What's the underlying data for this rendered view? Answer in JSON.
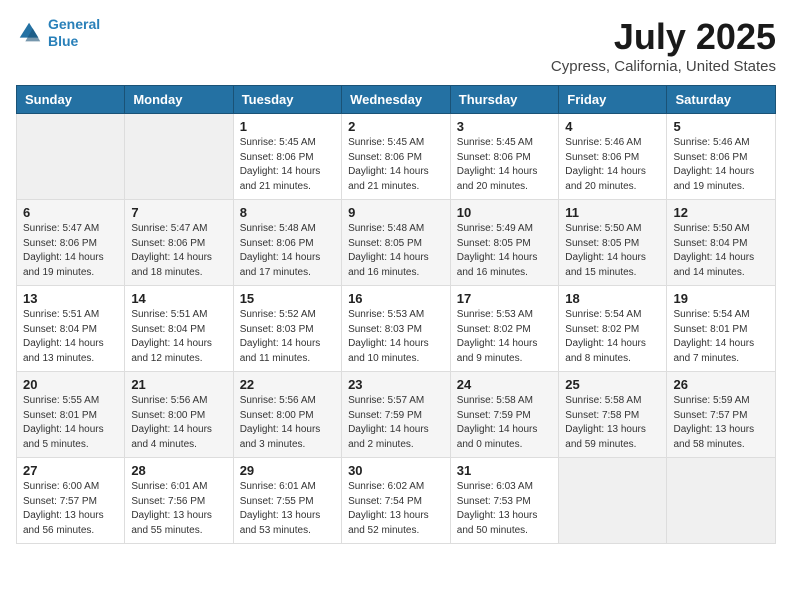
{
  "logo": {
    "line1": "General",
    "line2": "Blue"
  },
  "title": "July 2025",
  "subtitle": "Cypress, California, United States",
  "weekdays": [
    "Sunday",
    "Monday",
    "Tuesday",
    "Wednesday",
    "Thursday",
    "Friday",
    "Saturday"
  ],
  "weeks": [
    [
      {
        "day": "",
        "info": ""
      },
      {
        "day": "",
        "info": ""
      },
      {
        "day": "1",
        "info": "Sunrise: 5:45 AM\nSunset: 8:06 PM\nDaylight: 14 hours and 21 minutes."
      },
      {
        "day": "2",
        "info": "Sunrise: 5:45 AM\nSunset: 8:06 PM\nDaylight: 14 hours and 21 minutes."
      },
      {
        "day": "3",
        "info": "Sunrise: 5:45 AM\nSunset: 8:06 PM\nDaylight: 14 hours and 20 minutes."
      },
      {
        "day": "4",
        "info": "Sunrise: 5:46 AM\nSunset: 8:06 PM\nDaylight: 14 hours and 20 minutes."
      },
      {
        "day": "5",
        "info": "Sunrise: 5:46 AM\nSunset: 8:06 PM\nDaylight: 14 hours and 19 minutes."
      }
    ],
    [
      {
        "day": "6",
        "info": "Sunrise: 5:47 AM\nSunset: 8:06 PM\nDaylight: 14 hours and 19 minutes."
      },
      {
        "day": "7",
        "info": "Sunrise: 5:47 AM\nSunset: 8:06 PM\nDaylight: 14 hours and 18 minutes."
      },
      {
        "day": "8",
        "info": "Sunrise: 5:48 AM\nSunset: 8:06 PM\nDaylight: 14 hours and 17 minutes."
      },
      {
        "day": "9",
        "info": "Sunrise: 5:48 AM\nSunset: 8:05 PM\nDaylight: 14 hours and 16 minutes."
      },
      {
        "day": "10",
        "info": "Sunrise: 5:49 AM\nSunset: 8:05 PM\nDaylight: 14 hours and 16 minutes."
      },
      {
        "day": "11",
        "info": "Sunrise: 5:50 AM\nSunset: 8:05 PM\nDaylight: 14 hours and 15 minutes."
      },
      {
        "day": "12",
        "info": "Sunrise: 5:50 AM\nSunset: 8:04 PM\nDaylight: 14 hours and 14 minutes."
      }
    ],
    [
      {
        "day": "13",
        "info": "Sunrise: 5:51 AM\nSunset: 8:04 PM\nDaylight: 14 hours and 13 minutes."
      },
      {
        "day": "14",
        "info": "Sunrise: 5:51 AM\nSunset: 8:04 PM\nDaylight: 14 hours and 12 minutes."
      },
      {
        "day": "15",
        "info": "Sunrise: 5:52 AM\nSunset: 8:03 PM\nDaylight: 14 hours and 11 minutes."
      },
      {
        "day": "16",
        "info": "Sunrise: 5:53 AM\nSunset: 8:03 PM\nDaylight: 14 hours and 10 minutes."
      },
      {
        "day": "17",
        "info": "Sunrise: 5:53 AM\nSunset: 8:02 PM\nDaylight: 14 hours and 9 minutes."
      },
      {
        "day": "18",
        "info": "Sunrise: 5:54 AM\nSunset: 8:02 PM\nDaylight: 14 hours and 8 minutes."
      },
      {
        "day": "19",
        "info": "Sunrise: 5:54 AM\nSunset: 8:01 PM\nDaylight: 14 hours and 7 minutes."
      }
    ],
    [
      {
        "day": "20",
        "info": "Sunrise: 5:55 AM\nSunset: 8:01 PM\nDaylight: 14 hours and 5 minutes."
      },
      {
        "day": "21",
        "info": "Sunrise: 5:56 AM\nSunset: 8:00 PM\nDaylight: 14 hours and 4 minutes."
      },
      {
        "day": "22",
        "info": "Sunrise: 5:56 AM\nSunset: 8:00 PM\nDaylight: 14 hours and 3 minutes."
      },
      {
        "day": "23",
        "info": "Sunrise: 5:57 AM\nSunset: 7:59 PM\nDaylight: 14 hours and 2 minutes."
      },
      {
        "day": "24",
        "info": "Sunrise: 5:58 AM\nSunset: 7:59 PM\nDaylight: 14 hours and 0 minutes."
      },
      {
        "day": "25",
        "info": "Sunrise: 5:58 AM\nSunset: 7:58 PM\nDaylight: 13 hours and 59 minutes."
      },
      {
        "day": "26",
        "info": "Sunrise: 5:59 AM\nSunset: 7:57 PM\nDaylight: 13 hours and 58 minutes."
      }
    ],
    [
      {
        "day": "27",
        "info": "Sunrise: 6:00 AM\nSunset: 7:57 PM\nDaylight: 13 hours and 56 minutes."
      },
      {
        "day": "28",
        "info": "Sunrise: 6:01 AM\nSunset: 7:56 PM\nDaylight: 13 hours and 55 minutes."
      },
      {
        "day": "29",
        "info": "Sunrise: 6:01 AM\nSunset: 7:55 PM\nDaylight: 13 hours and 53 minutes."
      },
      {
        "day": "30",
        "info": "Sunrise: 6:02 AM\nSunset: 7:54 PM\nDaylight: 13 hours and 52 minutes."
      },
      {
        "day": "31",
        "info": "Sunrise: 6:03 AM\nSunset: 7:53 PM\nDaylight: 13 hours and 50 minutes."
      },
      {
        "day": "",
        "info": ""
      },
      {
        "day": "",
        "info": ""
      }
    ]
  ]
}
